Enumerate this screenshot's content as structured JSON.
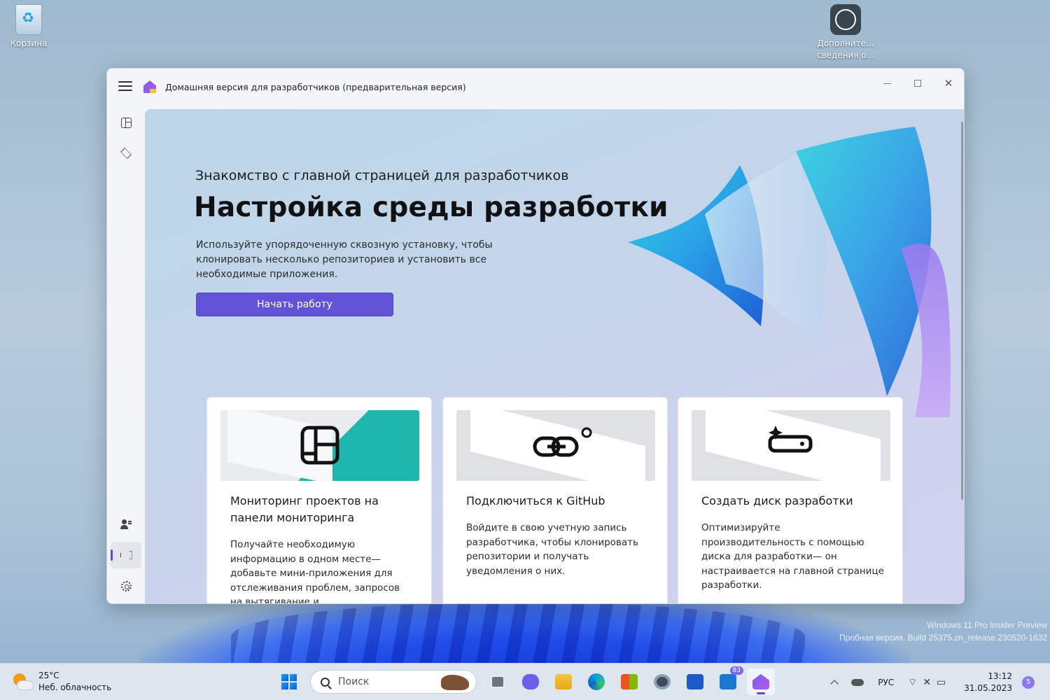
{
  "desktop": {
    "icons": [
      {
        "label": "Корзина"
      },
      {
        "label": "Дополните... сведения о..."
      }
    ],
    "watermark": {
      "line1": "Windows 11 Pro Insider Preview",
      "line2": "Пробная версия. Build 25375.zn_release.230520-1632"
    }
  },
  "window": {
    "title": "Домашняя версия для разработчиков (предварительная версия)",
    "hero": {
      "subtitle": "Знакомство с главной страницей для разработчиков",
      "title": "Настройка среды разработки",
      "description": "Используйте упорядоченную сквозную установку, чтобы клонировать несколько репозиториев и установить все необходимые приложения.",
      "button": "Начать работу"
    },
    "cards": [
      {
        "title": "Мониторинг проектов на панели мониторинга",
        "description": "Получайте необходимую информацию в одном месте— добавьте мини-приложения для отслеживания проблем, запросов на вытягивание и"
      },
      {
        "title": "Подключиться к GitHub",
        "description": "Войдите в свою учетную запись разработчика, чтобы клонировать репозитории и получать уведомления о них."
      },
      {
        "title": "Создать диск разработки",
        "description": "Оптимизируйте производительность с помощью диска для разработки— он настраивается на главной странице разработки."
      }
    ],
    "colors": {
      "accent": "#6252d6"
    }
  },
  "taskbar": {
    "weather": {
      "temp": "25°C",
      "condition": "Неб. облачность"
    },
    "search_placeholder": "Поиск",
    "teams_badge": "83",
    "language": "РУС",
    "time": "13:12",
    "date": "31.05.2023",
    "notifications": "5"
  }
}
